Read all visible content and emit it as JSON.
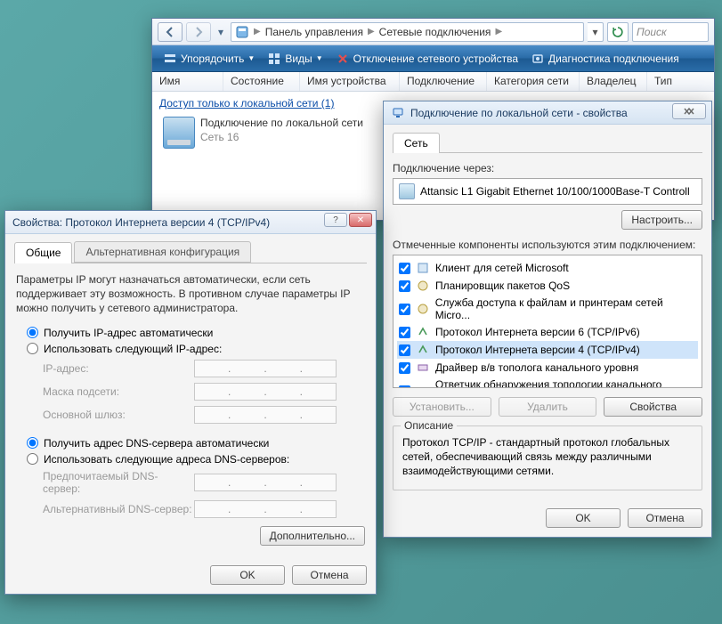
{
  "explorer": {
    "breadcrumb": {
      "seg1": "Панель управления",
      "seg2": "Сетевые подключения"
    },
    "search_placeholder": "Поиск",
    "cmdbar": {
      "organize": "Упорядочить",
      "views": "Виды",
      "disable": "Отключение сетевого устройства",
      "diagnose": "Диагностика подключения"
    },
    "columns": {
      "name": "Имя",
      "state": "Состояние",
      "device": "Имя устройства",
      "connection": "Подключение",
      "category": "Категория сети",
      "owner": "Владелец",
      "type": "Тип"
    },
    "group_header": "Доступ только к локальной сети (1)",
    "conn_name": "Подключение по локальной сети",
    "conn_net": "Сеть 16"
  },
  "props": {
    "title": "Подключение по локальной сети - свойства",
    "tab_network": "Сеть",
    "connect_using": "Подключение через:",
    "adapter": "Attansic L1 Gigabit Ethernet 10/100/1000Base-T Controll",
    "configure": "Настроить...",
    "components_label": "Отмеченные компоненты используются этим подключением:",
    "components": [
      "Клиент для сетей Microsoft",
      "Планировщик пакетов QoS",
      "Служба доступа к файлам и принтерам сетей Micro...",
      "Протокол Интернета версии 6 (TCP/IPv6)",
      "Протокол Интернета версии 4 (TCP/IPv4)",
      "Драйвер в/в тополога канального уровня",
      "Ответчик обнаружения топологии канального уровня"
    ],
    "install": "Установить...",
    "uninstall": "Удалить",
    "properties": "Свойства",
    "desc_legend": "Описание",
    "desc_text": "Протокол TCP/IP - стандартный протокол глобальных сетей, обеспечивающий связь между различными взаимодействующими сетями.",
    "ok": "OK",
    "cancel": "Отмена"
  },
  "ipv4": {
    "title": "Свойства: Протокол Интернета версии 4 (TCP/IPv4)",
    "tab_general": "Общие",
    "tab_alt": "Альтернативная конфигурация",
    "desc": "Параметры IP могут назначаться автоматически, если сеть поддерживает эту возможность. В противном случае параметры IP можно получить у сетевого администратора.",
    "ip_auto": "Получить IP-адрес автоматически",
    "ip_manual": "Использовать следующий IP-адрес:",
    "ip_addr": "IP-адрес:",
    "mask": "Маска подсети:",
    "gateway": "Основной шлюз:",
    "dns_auto": "Получить адрес DNS-сервера автоматически",
    "dns_manual": "Использовать следующие адреса DNS-серверов:",
    "dns1": "Предпочитаемый DNS-сервер:",
    "dns2": "Альтернативный DNS-сервер:",
    "advanced": "Дополнительно...",
    "ok": "OK",
    "cancel": "Отмена"
  }
}
